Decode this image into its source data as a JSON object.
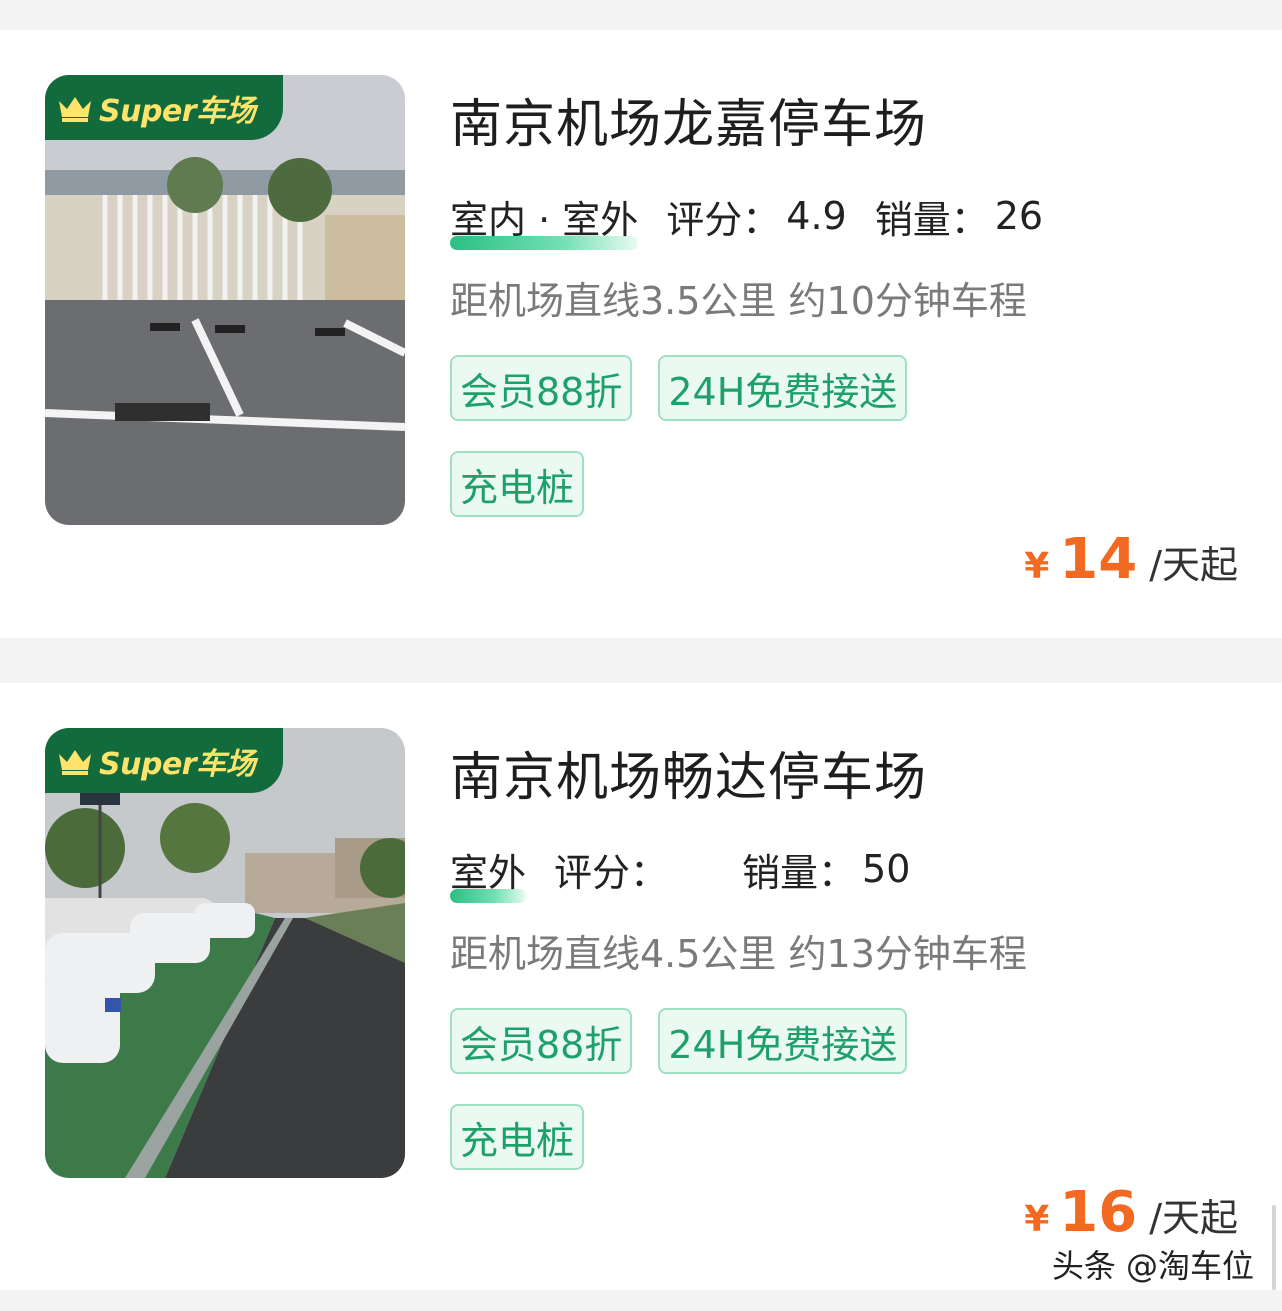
{
  "badge": {
    "text": "Super车场"
  },
  "colors": {
    "brand_green": "#116b3d",
    "tag_green": "#1fa06a",
    "price_orange": "#f26a22"
  },
  "listings": [
    {
      "name": "南京机场龙嘉停车场",
      "env": "室内 · 室外",
      "rating_label": "评分：",
      "rating_value": "4.9",
      "sales_label": "销量：",
      "sales_value": "26",
      "distance": "距机场直线3.5公里 约10分钟车程",
      "tags": [
        "会员88折",
        "24H免费接送",
        "充电桩"
      ],
      "price_symbol": "¥",
      "price_value": "14",
      "price_unit": "/天起"
    },
    {
      "name": "南京机场畅达停车场",
      "env": "室外",
      "rating_label": "评分：",
      "rating_value": "",
      "sales_label": "销量：",
      "sales_value": "50",
      "distance": "距机场直线4.5公里 约13分钟车程",
      "tags": [
        "会员88折",
        "24H免费接送",
        "充电桩"
      ],
      "price_symbol": "¥",
      "price_value": "16",
      "price_unit": "/天起"
    }
  ],
  "watermark": "头条 @淘车位"
}
